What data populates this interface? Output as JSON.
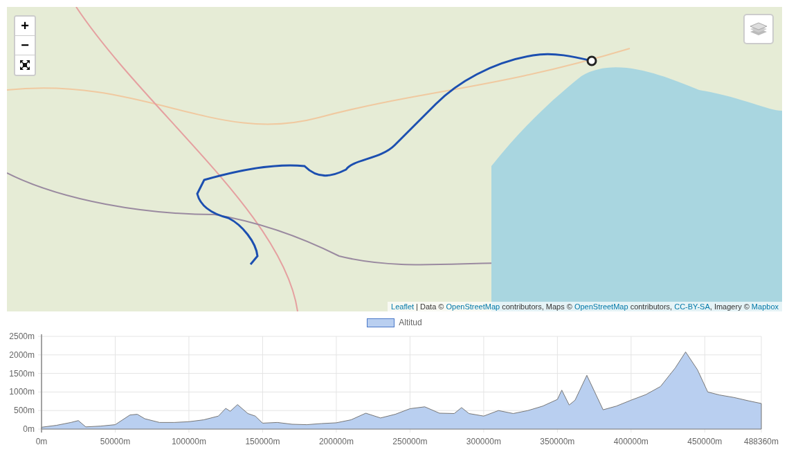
{
  "map": {
    "zoom_in": "+",
    "zoom_out": "−",
    "attribution": [
      {
        "text": "Leaflet",
        "link": true
      },
      {
        "text": " | Data © ",
        "link": false
      },
      {
        "text": "OpenStreetMap",
        "link": true
      },
      {
        "text": " contributors, Maps © ",
        "link": false
      },
      {
        "text": "OpenStreetMap",
        "link": true
      },
      {
        "text": " contributors, ",
        "link": false
      },
      {
        "text": "CC-BY-SA",
        "link": true
      },
      {
        "text": ", Imagery © ",
        "link": false
      },
      {
        "text": "Mapbox",
        "link": true
      }
    ]
  },
  "chart": {
    "chart_data": {
      "type": "area",
      "grid": true,
      "xlim": [
        0,
        488360
      ],
      "ylim": [
        0,
        2500
      ],
      "xticks": [
        {
          "value": 0,
          "label": "0m"
        },
        {
          "value": 50000,
          "label": "50000m"
        },
        {
          "value": 100000,
          "label": "100000m"
        },
        {
          "value": 150000,
          "label": "150000m"
        },
        {
          "value": 200000,
          "label": "200000m"
        },
        {
          "value": 250000,
          "label": "250000m"
        },
        {
          "value": 300000,
          "label": "300000m"
        },
        {
          "value": 350000,
          "label": "350000m"
        },
        {
          "value": 400000,
          "label": "400000m"
        },
        {
          "value": 450000,
          "label": "450000m"
        },
        {
          "value": 488360,
          "label": "488360m"
        }
      ],
      "yticks": [
        {
          "value": 0,
          "label": "0m"
        },
        {
          "value": 500,
          "label": "500m"
        },
        {
          "value": 1000,
          "label": "1000m"
        },
        {
          "value": 1500,
          "label": "1500m"
        },
        {
          "value": 2000,
          "label": "2000m"
        },
        {
          "value": 2500,
          "label": "2500m"
        }
      ],
      "x": [
        0,
        10000,
        20000,
        25000,
        30000,
        40000,
        50000,
        60000,
        65000,
        70000,
        80000,
        90000,
        100000,
        110000,
        120000,
        125000,
        128000,
        133000,
        140000,
        145000,
        150000,
        160000,
        170000,
        180000,
        190000,
        200000,
        210000,
        220000,
        230000,
        240000,
        250000,
        260000,
        270000,
        280000,
        285000,
        290000,
        300000,
        310000,
        320000,
        330000,
        340000,
        350000,
        353000,
        358000,
        362000,
        370000,
        381000,
        390000,
        400000,
        410000,
        420000,
        430000,
        437000,
        445000,
        452000,
        460000,
        470000,
        480000,
        488360
      ],
      "series": [
        {
          "name": "Altitud",
          "color": "#b9cff0",
          "values": [
            50,
            100,
            180,
            230,
            60,
            80,
            120,
            380,
            400,
            280,
            180,
            180,
            200,
            250,
            350,
            560,
            480,
            660,
            420,
            350,
            160,
            180,
            130,
            120,
            150,
            170,
            250,
            430,
            300,
            400,
            550,
            600,
            430,
            420,
            580,
            420,
            350,
            500,
            420,
            500,
            620,
            800,
            1050,
            650,
            780,
            1450,
            520,
            620,
            780,
            930,
            1150,
            1650,
            2080,
            1600,
            1000,
            920,
            850,
            760,
            690
          ]
        }
      ]
    }
  }
}
